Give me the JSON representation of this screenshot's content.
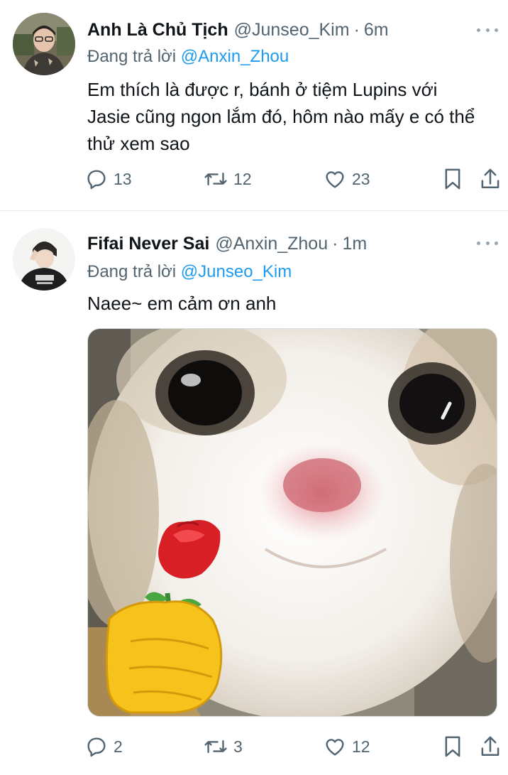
{
  "tweets": [
    {
      "display_name": "Anh Là Chủ Tịch",
      "handle": "@Junseo_Kim",
      "separator": "·",
      "time": "6m",
      "reply_prefix": "Đang trả lời ",
      "reply_to": "@Anxin_Zhou",
      "text": "Em thích là được r, bánh ở tiệm Lupins với Jasie cũng ngon lắm đó, hôm nào mấy e có thể thử xem sao",
      "replies": "13",
      "retweets": "12",
      "likes": "23",
      "avatar_icon": "profile-photo"
    },
    {
      "display_name": "Fifai Never Sai",
      "handle": "@Anxin_Zhou",
      "separator": "·",
      "time": "1m",
      "reply_prefix": "Đang trả lời ",
      "reply_to": "@Junseo_Kim",
      "text": "Naee~ em cảm ơn anh",
      "media_icon": "cat-holding-rose-image",
      "replies": "2",
      "retweets": "3",
      "likes": "12",
      "avatar_icon": "profile-photo"
    }
  ],
  "icons": {
    "reply": "reply-icon",
    "retweet": "retweet-icon",
    "like": "heart-icon",
    "bookmark": "bookmark-icon",
    "share": "share-icon",
    "more": "more-options-icon"
  },
  "colors": {
    "text_primary": "#0f1419",
    "text_secondary": "#536471",
    "link": "#1d9bf0",
    "divider": "#e6e9eb"
  }
}
